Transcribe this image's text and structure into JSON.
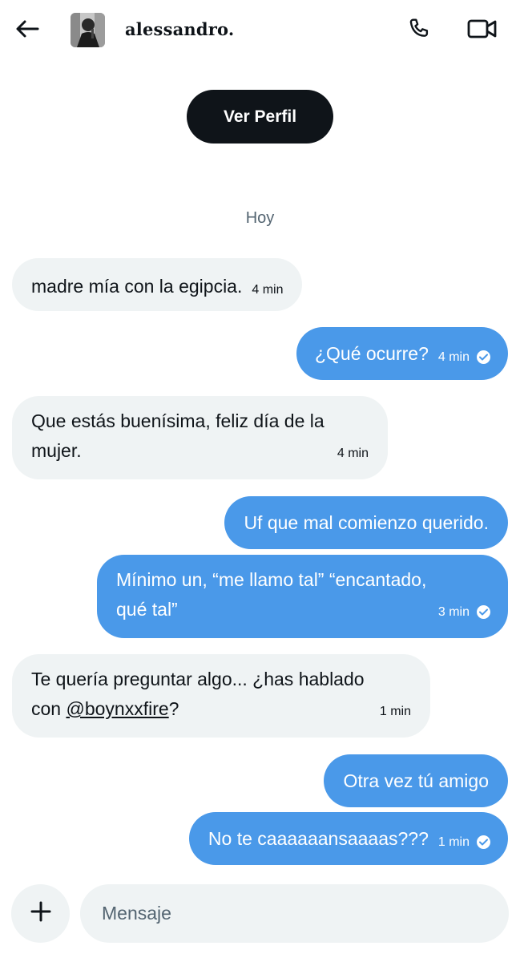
{
  "header": {
    "username": "alessandro.",
    "back_icon": "arrow-left-icon",
    "call_icon": "phone-icon",
    "video_icon": "video-camera-icon"
  },
  "profile_button": {
    "label": "Ver Perfil"
  },
  "day_separator": "Hoy",
  "messages": [
    {
      "direction": "received",
      "text": "madre mía con la egipcia.",
      "time": "4 min"
    },
    {
      "direction": "sent",
      "text": "¿Qué ocurre?",
      "time": "4 min",
      "read": true
    },
    {
      "direction": "received",
      "text_line1": "Que estás buenísima, feliz día de la",
      "text_line2": "mujer.",
      "time": "4 min"
    },
    {
      "direction": "sent",
      "text": "Uf que mal comienzo querido."
    },
    {
      "direction": "sent",
      "text_line1": "Mínimo un, “me llamo tal” “encantado,",
      "text_line2": "qué tal”",
      "time": "3 min",
      "read": true
    },
    {
      "direction": "received",
      "text_line1": "Te quería preguntar algo... ¿has hablado",
      "text_line2_prefix": "con ",
      "mention": "@boynxxfire",
      "text_line2_suffix": "?",
      "time": "1 min"
    },
    {
      "direction": "sent",
      "text": "Otra vez tú amigo"
    },
    {
      "direction": "sent",
      "text": "No te caaaaaansaaaas???",
      "time": "1 min",
      "read": true
    }
  ],
  "composer": {
    "placeholder": "Mensaje",
    "value": "",
    "add_icon": "plus-icon"
  },
  "colors": {
    "sent_bubble": "#4a99e9",
    "received_bubble": "#eff3f4",
    "profile_button": "#0f1419",
    "muted_text": "#536471"
  }
}
